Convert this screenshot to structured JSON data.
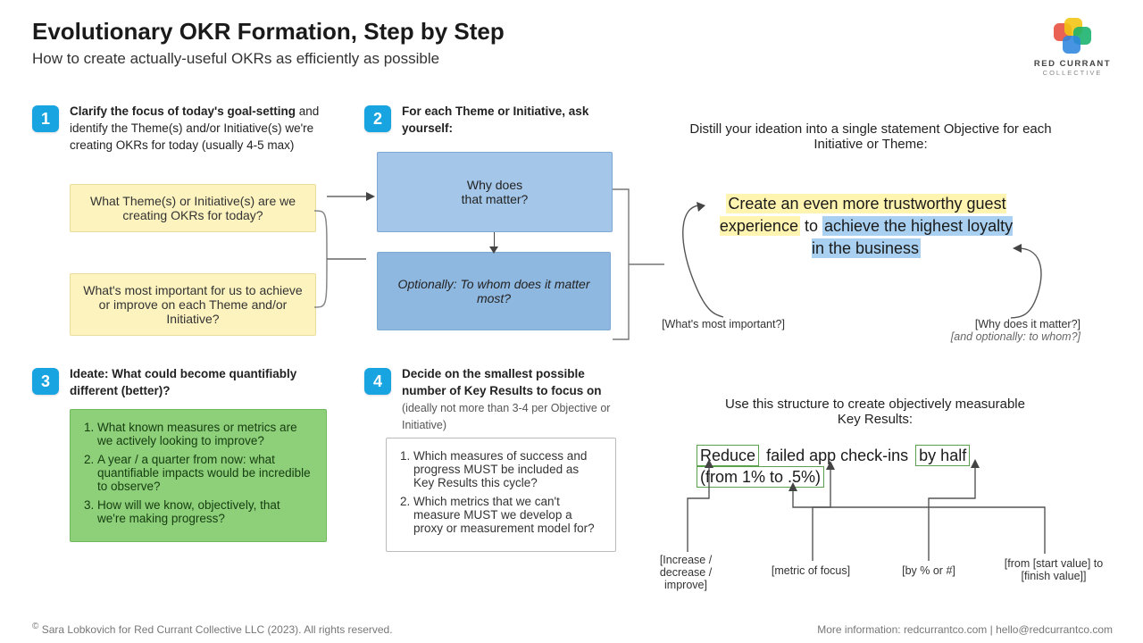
{
  "header": {
    "title": "Evolutionary OKR Formation, Step by Step",
    "subtitle": "How to create actually-useful OKRs as efficiently as possible"
  },
  "brand": {
    "line1": "RED CURRANT",
    "line2": "COLLECTIVE"
  },
  "steps": {
    "s1": {
      "num": "1",
      "bold": "Clarify the focus of today's goal-setting",
      "rest": " and identify the Theme(s) and/or Initiative(s) we're creating OKRs for today (usually 4-5 max)",
      "q1": "What Theme(s) or Initiative(s) are we creating OKRs for today?",
      "q2": "What's most important for us to achieve or improve on each Theme and/or Initiative?"
    },
    "s2": {
      "num": "2",
      "bold": "For each Theme or Initiative, ask yourself:",
      "box1": "Why does\nthat matter?",
      "box2": "Optionally: To whom does it matter most?"
    },
    "s3": {
      "num": "3",
      "bold": "Ideate: What could become quantifiably different (better)?",
      "li1": "What known measures or metrics are we actively looking to improve?",
      "li2": "A year / a quarter from now: what quantifiable impacts would be incredible to observe?",
      "li3": "How will we know, objectively, that we're making progress?"
    },
    "s4": {
      "num": "4",
      "bold": "Decide on the smallest possible number of Key Results to focus on",
      "note": "(ideally not more than 3-4 per Objective or Initiative)",
      "li1": "Which measures of success and progress MUST be included as Key Results this cycle?",
      "li2": "Which metrics that we can't measure MUST we develop a proxy or measurement model for?"
    }
  },
  "right": {
    "distill": "Distill your ideation into a single statement Objective for each Initiative or Theme:",
    "obj_yellow": "Create an even more trustworthy guest experience",
    "obj_mid": " to ",
    "obj_blue": "achieve the highest loyalty in the business",
    "ann_left": "[What's most important?]",
    "ann_right1": "[Why does it matter?]",
    "ann_right2": "[and optionally: to whom?]",
    "kr_intro": "Use this structure to create objectively measurable Key Results:",
    "kr_reduce": "Reduce",
    "kr_metric": "failed app check-ins",
    "kr_by": "by half",
    "kr_from": "(from 1% to .5%)",
    "kr_ann1": "[Increase / decrease / improve]",
    "kr_ann2": "[metric of focus]",
    "kr_ann3": "[by % or #]",
    "kr_ann4": "[from [start value] to [finish value]]"
  },
  "footer": {
    "left": " Sara Lobkovich for Red Currant Collective LLC (2023). All rights reserved.",
    "right": "More information: redcurrantco.com | hello@redcurrantco.com"
  }
}
